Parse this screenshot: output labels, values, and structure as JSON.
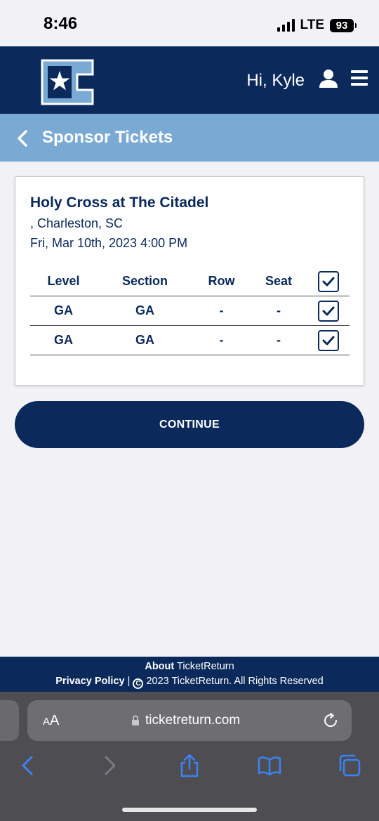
{
  "status": {
    "time": "8:46",
    "network": "LTE",
    "battery": "93"
  },
  "header": {
    "logo_icon": "citadel-c-star-logo",
    "greeting": "Hi, Kyle",
    "user_icon": "user-icon",
    "menu_icon": "hamburger-menu-icon"
  },
  "titlebar": {
    "back_icon": "chevron-left-icon",
    "title": "Sponsor Tickets"
  },
  "event": {
    "title": "Holy Cross at The Citadel",
    "location": ", Charleston, SC",
    "date": "Fri, Mar 10th, 2023 4:00 PM"
  },
  "table": {
    "headers": [
      "Level",
      "Section",
      "Row",
      "Seat"
    ],
    "rows": [
      {
        "level": "GA",
        "section": "GA",
        "row": "-",
        "seat": "-",
        "checked": true
      },
      {
        "level": "GA",
        "section": "GA",
        "row": "-",
        "seat": "-",
        "checked": true
      }
    ],
    "select_all_checked": true
  },
  "continue_label": "CONTINUE",
  "footer": {
    "about_bold": "About",
    "about_rest": "TicketReturn",
    "privacy": "Privacy Policy",
    "separator": "|",
    "copyright_symbol": "C",
    "copyright_text": "2023 TicketReturn. All Rights Reserved"
  },
  "browser": {
    "text_size_label_small": "A",
    "text_size_label_large": "A",
    "url": "ticketreturn.com"
  },
  "colors": {
    "navy": "#0b2a5b",
    "light_blue": "#7aaad4",
    "page_bg": "#f2f1f6",
    "browser_bg": "#4e4e52",
    "ios_blue": "#3b82f6"
  }
}
